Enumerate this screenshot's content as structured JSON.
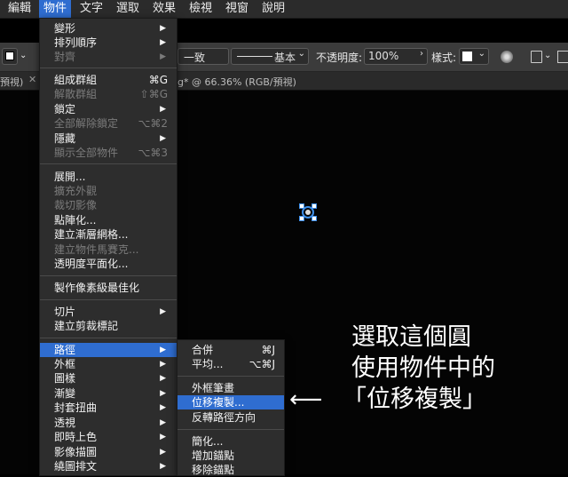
{
  "menubar": {
    "items": [
      "編輯",
      "物件",
      "文字",
      "選取",
      "效果",
      "檢視",
      "視窗",
      "說明"
    ]
  },
  "toolbar": {
    "stroke_label": "一致",
    "profile_label": "基本",
    "opacity_label": "不透明度:",
    "opacity_value": "100%",
    "style_label": "樣式:"
  },
  "tabs": {
    "left_tab": "預視)",
    "doc_tab": "g* @ 66.36% (RGB/預視)"
  },
  "object_menu": {
    "items": [
      {
        "label": "變形",
        "submenu": true,
        "enabled": true
      },
      {
        "label": "排列順序",
        "submenu": true,
        "enabled": true
      },
      {
        "label": "對齊",
        "submenu": true,
        "enabled": false
      },
      {
        "label": "組成群組",
        "shortcut": "⌘G",
        "enabled": true
      },
      {
        "label": "解散群組",
        "shortcut": "⇧⌘G",
        "enabled": false
      },
      {
        "label": "鎖定",
        "submenu": true,
        "enabled": true
      },
      {
        "label": "全部解除鎖定",
        "shortcut": "⌥⌘2",
        "enabled": false
      },
      {
        "label": "隱藏",
        "submenu": true,
        "enabled": true
      },
      {
        "label": "顯示全部物件",
        "shortcut": "⌥⌘3",
        "enabled": false
      },
      {
        "label": "展開...",
        "enabled": true
      },
      {
        "label": "擴充外觀",
        "enabled": false
      },
      {
        "label": "裁切影像",
        "enabled": false
      },
      {
        "label": "點陣化...",
        "enabled": true
      },
      {
        "label": "建立漸層網格...",
        "enabled": true
      },
      {
        "label": "建立物件馬賽克...",
        "enabled": false
      },
      {
        "label": "透明度平面化...",
        "enabled": true
      },
      {
        "label": "製作像素級最佳化",
        "enabled": true
      },
      {
        "label": "切片",
        "submenu": true,
        "enabled": true
      },
      {
        "label": "建立剪裁標記",
        "enabled": true
      },
      {
        "label": "路徑",
        "submenu": true,
        "enabled": true,
        "highlighted": true
      },
      {
        "label": "外框",
        "submenu": true,
        "enabled": true
      },
      {
        "label": "圖樣",
        "submenu": true,
        "enabled": true
      },
      {
        "label": "漸變",
        "submenu": true,
        "enabled": true
      },
      {
        "label": "封套扭曲",
        "submenu": true,
        "enabled": true
      },
      {
        "label": "透視",
        "submenu": true,
        "enabled": true
      },
      {
        "label": "即時上色",
        "submenu": true,
        "enabled": true
      },
      {
        "label": "影像描圖",
        "submenu": true,
        "enabled": true
      },
      {
        "label": "繞圖排文",
        "submenu": true,
        "enabled": true
      }
    ]
  },
  "path_submenu": {
    "items": [
      {
        "label": "合併",
        "shortcut": "⌘J"
      },
      {
        "label": "平均...",
        "shortcut": "⌥⌘J"
      },
      {
        "label": "外框筆畫"
      },
      {
        "label": "位移複製...",
        "highlighted": true
      },
      {
        "label": "反轉路徑方向"
      },
      {
        "label": "簡化..."
      },
      {
        "label": "增加錨點"
      },
      {
        "label": "移除錨點"
      }
    ]
  },
  "annotation": {
    "line1": "選取這個圓",
    "line2": "使用物件中的",
    "line3": "「位移複製」",
    "arrow": "⟵"
  },
  "colors": {
    "menu_bg": "#2d2d2d",
    "highlight": "#2f6dd0",
    "selection": "#3d8ee8"
  }
}
